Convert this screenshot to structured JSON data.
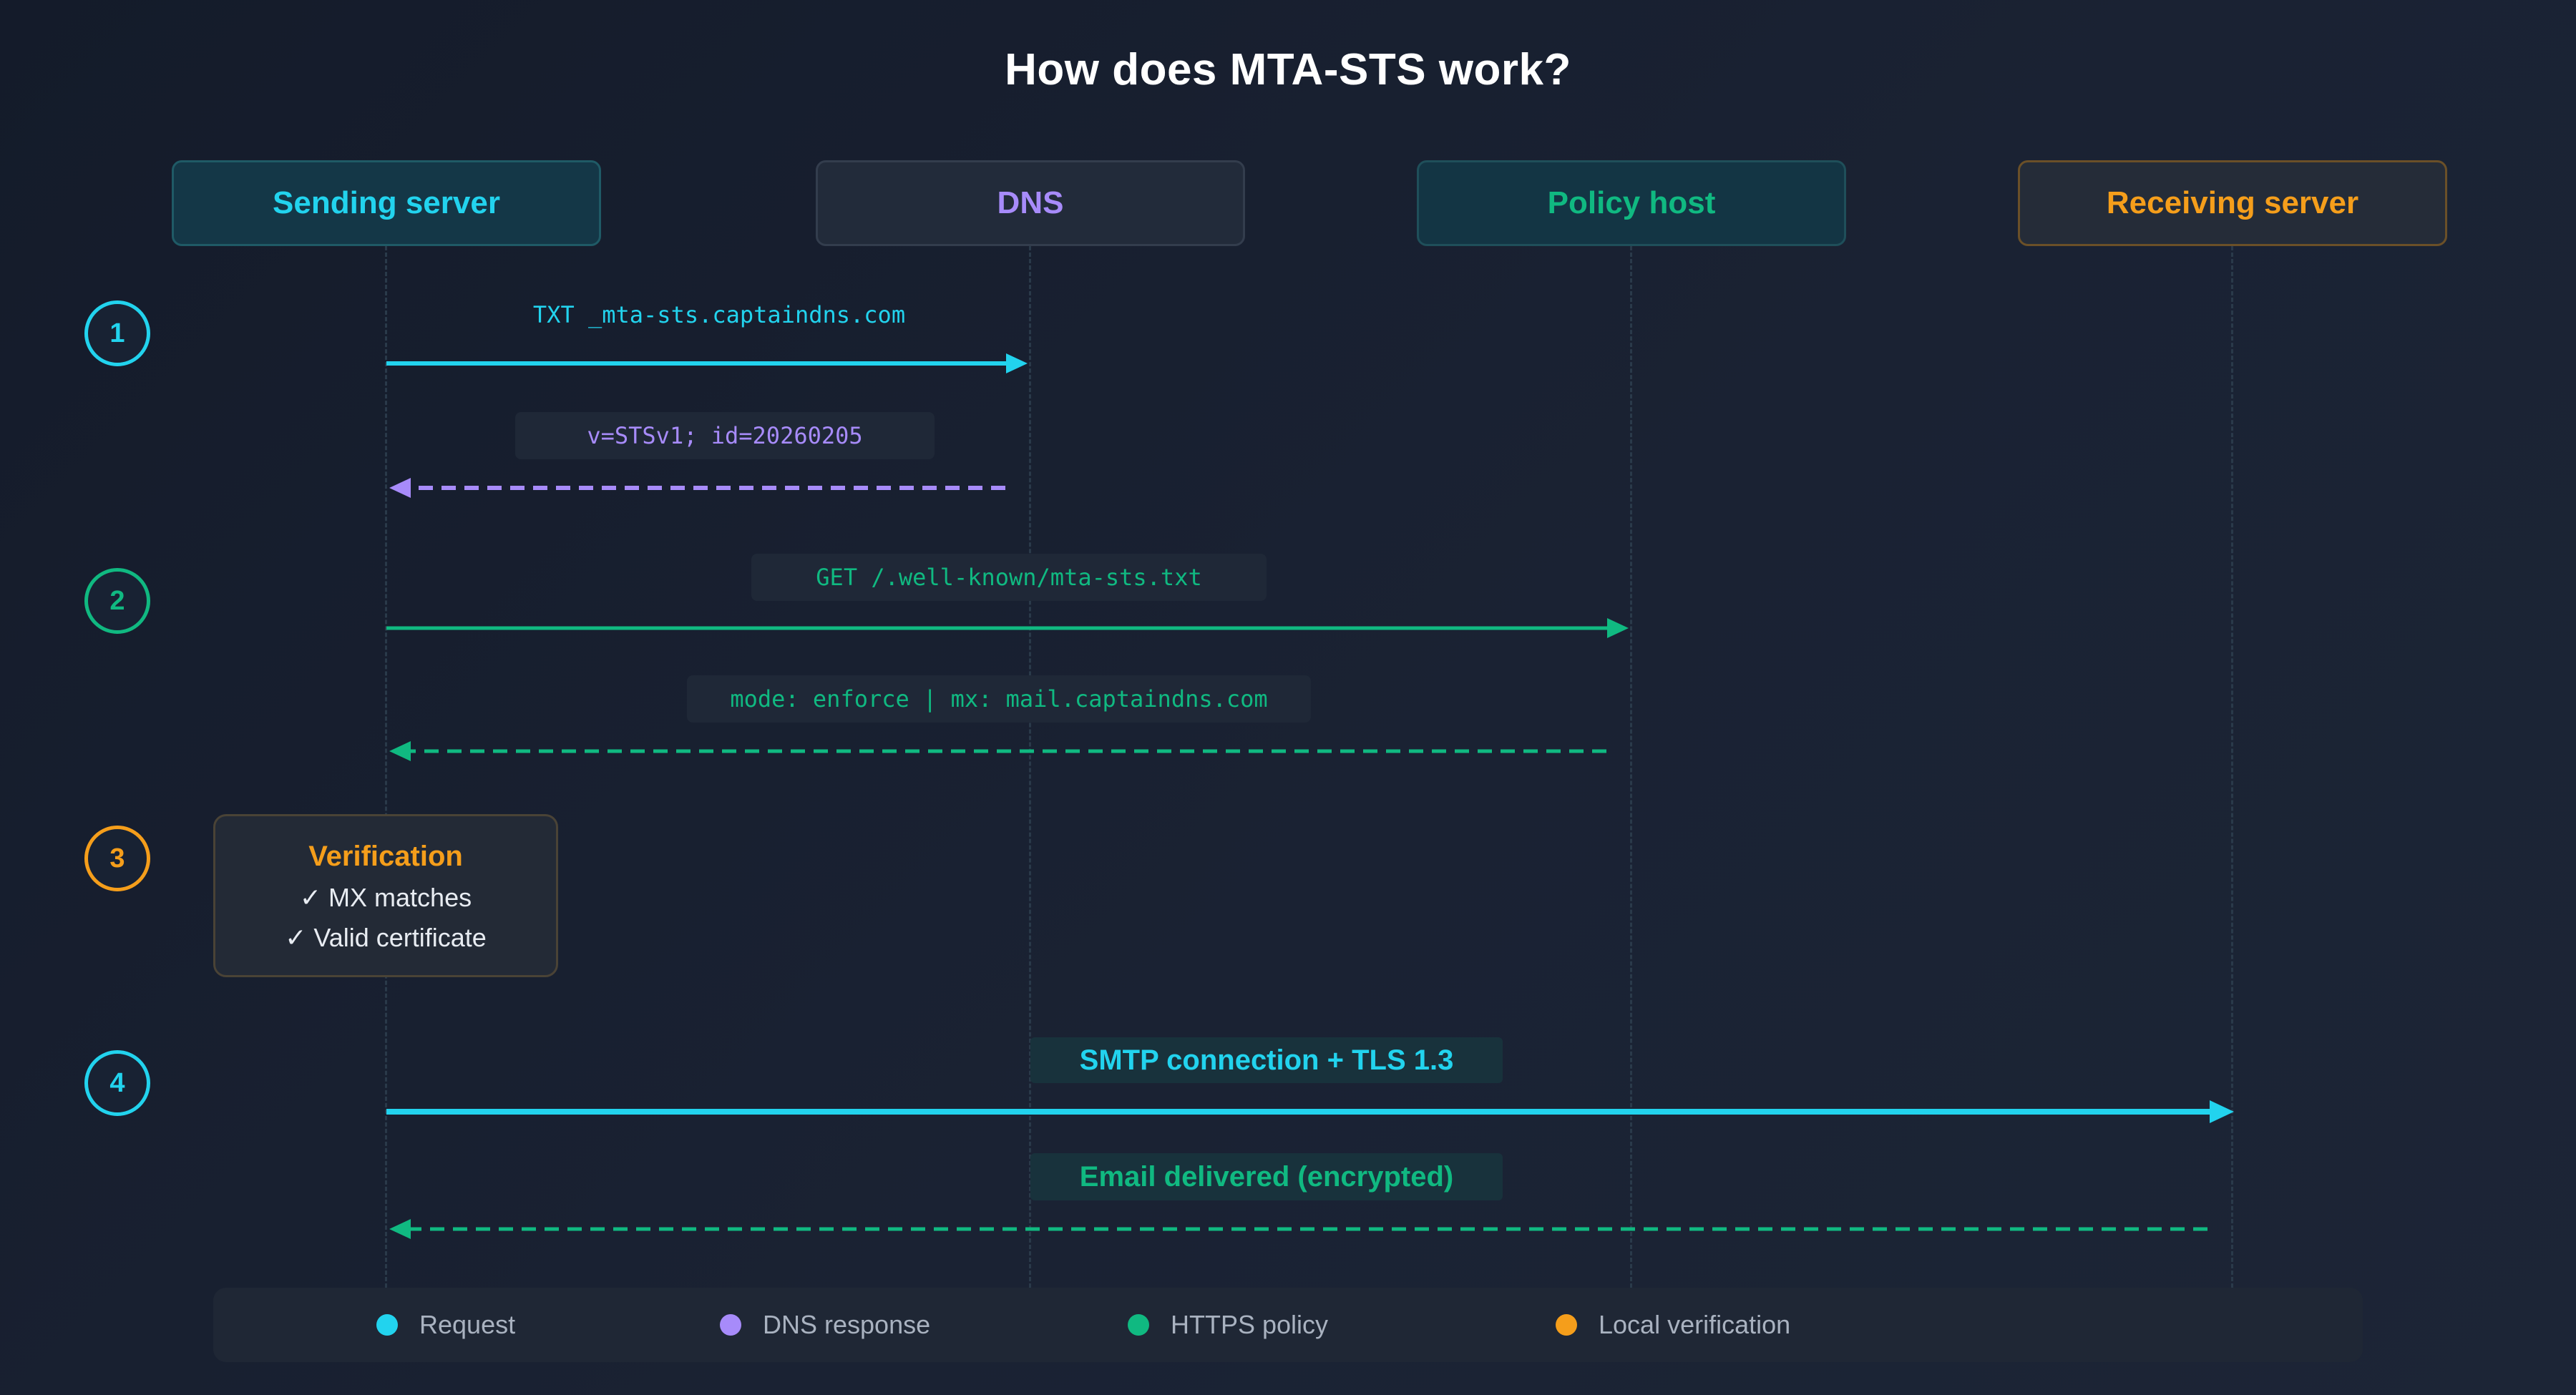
{
  "title": "How does MTA-STS work?",
  "actors": {
    "sending": "Sending server",
    "dns": "DNS",
    "policy": "Policy host",
    "receiving": "Receiving server"
  },
  "steps": [
    "1",
    "2",
    "3",
    "4"
  ],
  "messages": {
    "txt_query": "TXT _mta-sts.captaindns.com",
    "txt_response": "v=STSv1; id=20260205",
    "https_get": "GET /.well-known/mta-sts.txt",
    "policy_response": "mode: enforce | mx: mail.captaindns.com",
    "smtp": "SMTP connection + TLS 1.3",
    "delivered": "Email delivered (encrypted)"
  },
  "verification": {
    "title": "Verification",
    "items": [
      "✓ MX matches",
      "✓ Valid certificate"
    ]
  },
  "legend": [
    {
      "label": "Request",
      "color": "#22d3ee"
    },
    {
      "label": "DNS response",
      "color": "#a78bfa"
    },
    {
      "label": "HTTPS policy",
      "color": "#10b981"
    },
    {
      "label": "Local verification",
      "color": "#f59e1b"
    }
  ],
  "colors": {
    "request": "#22d3ee",
    "dns_response": "#a78bfa",
    "https_policy": "#10b981",
    "local_verification": "#f59e1b"
  }
}
